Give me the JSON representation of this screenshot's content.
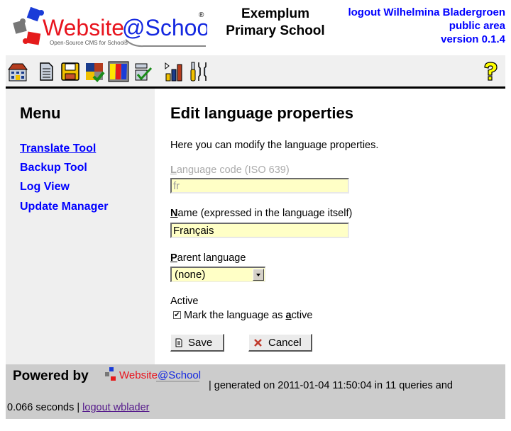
{
  "header": {
    "logo_text_red": "Website",
    "logo_text_blue": "@School",
    "logo_tagline": "Open-Source CMS for Schools",
    "logo_registered": "®",
    "school_name_line1": "Exemplum",
    "school_name_line2": "Primary School",
    "logout_link": "logout Wilhelmina Bladergroen",
    "area_link": "public area",
    "version": "version 0.1.4"
  },
  "toolbar": {
    "items": [
      {
        "name": "start-center",
        "icon": "house-icon"
      },
      {
        "name": "page-manager",
        "icon": "document-icon"
      },
      {
        "name": "file-manager",
        "icon": "floppy-icon"
      },
      {
        "name": "module-manager",
        "icon": "puzzle-icon"
      },
      {
        "name": "account-manager",
        "icon": "users-icon"
      },
      {
        "name": "configuration-manager",
        "icon": "checklist-icon"
      },
      {
        "name": "statistics",
        "icon": "bar-chart-icon"
      },
      {
        "name": "tools",
        "icon": "tools-icon"
      }
    ],
    "help_icon": "help-icon"
  },
  "sidebar": {
    "title": "Menu",
    "items": [
      {
        "label": "Translate Tool",
        "active": true
      },
      {
        "label": "Backup Tool",
        "active": false
      },
      {
        "label": "Log View",
        "active": false
      },
      {
        "label": "Update Manager",
        "active": false
      }
    ]
  },
  "form": {
    "title": "Edit language properties",
    "intro": "Here you can modify the language properties.",
    "language_code": {
      "label_accesskey": "L",
      "label_rest": "anguage code (ISO 639)",
      "value": "fr",
      "disabled": true
    },
    "name": {
      "label_accesskey": "N",
      "label_rest": "ame (expressed in the language itself)",
      "value": "Français"
    },
    "parent": {
      "label_accesskey": "P",
      "label_rest": "arent language",
      "selected": "(none)"
    },
    "active": {
      "heading": "Active",
      "checkbox_pre": "Mark the language as ",
      "checkbox_accesskey": "a",
      "checkbox_post": "ctive",
      "checked": true
    },
    "save_label": "Save",
    "cancel_label": "Cancel"
  },
  "footer": {
    "powered_by": "Powered by",
    "generated": "| generated on 2011-01-04 11:50:04 in 11 queries and",
    "seconds": "0.066 seconds | ",
    "logout_link": "logout wblader"
  },
  "colors": {
    "link": "#0000ff",
    "input_bg": "#ffffc6",
    "sidebar_bg": "#efefef",
    "footer_bg": "#cccccc",
    "logo_red": "#e8141e",
    "logo_blue": "#1428e0"
  }
}
